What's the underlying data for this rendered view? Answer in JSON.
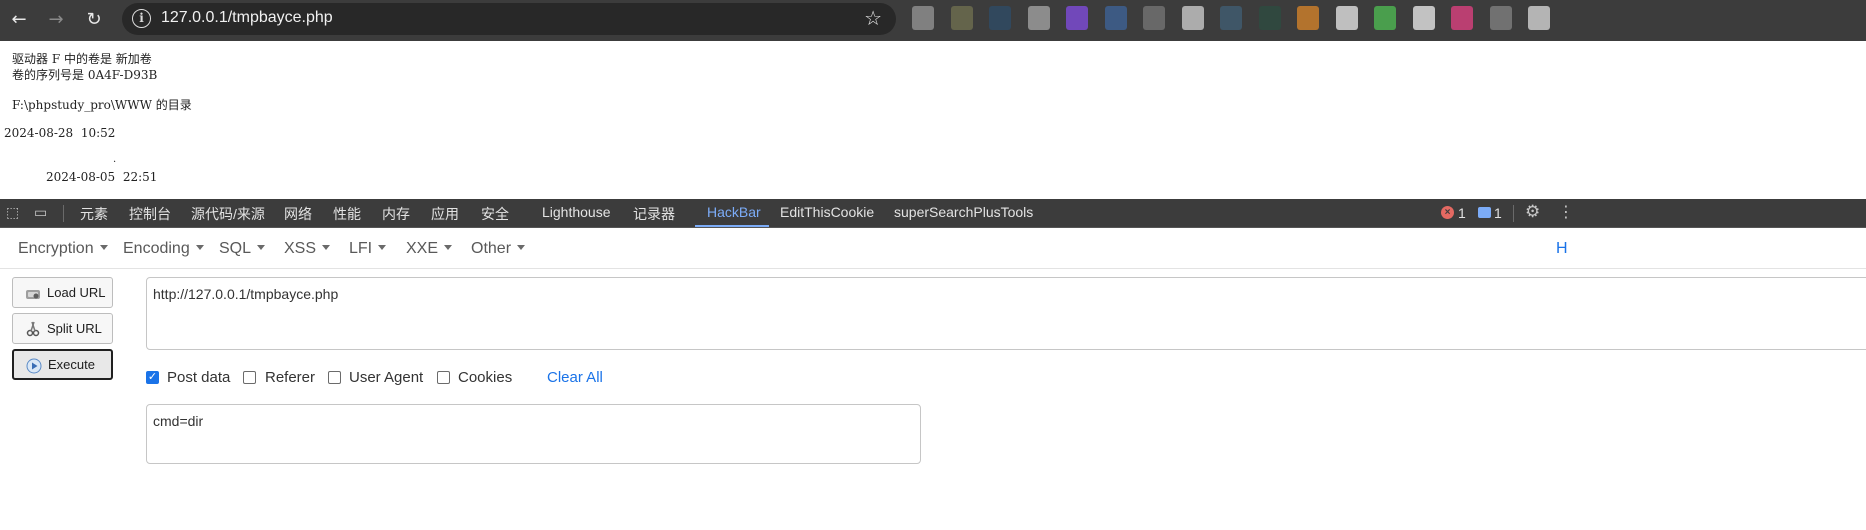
{
  "browser": {
    "url": "127.0.0.1/tmpbayce.php",
    "back_icon": "←",
    "forward_icon": "→",
    "reload_icon": "↻",
    "bookmark_icon": "☆",
    "info_icon": "i",
    "extension_colors": [
      "#8c8c8c",
      "#6b6b4e",
      "#2f4a63",
      "#9a9a9a",
      "#7a4ad0",
      "#3d5f8f",
      "#707070",
      "#bfbfbf",
      "#3f5b6f",
      "#2e4a40",
      "#c87c2a",
      "#d6d6d6",
      "#4caf50",
      "#d9d9d9",
      "#d0407a",
      "#7a7a7a",
      "#c9c9c9"
    ]
  },
  "page_output": {
    "line1": "驱动器 F 中的卷是 新加卷",
    "line2": "卷的序列号是 0A4F-D93B",
    "line3": "F:\\phpstudy_pro\\WWW 的目录",
    "line4": "2024-08-28  10:52",
    "line5_dot": ".",
    "line6": "2024-08-05  22:51"
  },
  "devtools": {
    "tabs": [
      "元素",
      "控制台",
      "源代码/来源",
      "网络",
      "性能",
      "内存",
      "应用",
      "安全",
      "Lighthouse",
      "记录器",
      "HackBar",
      "EditThisCookie",
      "superSearchPlusTools"
    ],
    "active_tab": "HackBar",
    "error_count": "1",
    "message_count": "1",
    "inspect_icon": "⬚",
    "device_icon": "▭",
    "settings_icon": "⚙",
    "more_icon": "⋮",
    "error_icon": "×"
  },
  "hackbar": {
    "menu": [
      "Encryption",
      "Encoding",
      "SQL",
      "XSS",
      "LFI",
      "XXE",
      "Other"
    ],
    "menu_right": "H",
    "buttons": {
      "load": "Load URL",
      "split": "Split URL",
      "execute": "Execute"
    },
    "url_value": "http://127.0.0.1/tmpbayce.php",
    "options": {
      "post_data": {
        "label": "Post data",
        "checked": true
      },
      "referer": {
        "label": "Referer",
        "checked": false
      },
      "user_agent": {
        "label": "User Agent",
        "checked": false
      },
      "cookies": {
        "label": "Cookies",
        "checked": false
      }
    },
    "clear_all": "Clear All",
    "post_value": "cmd=dir"
  }
}
